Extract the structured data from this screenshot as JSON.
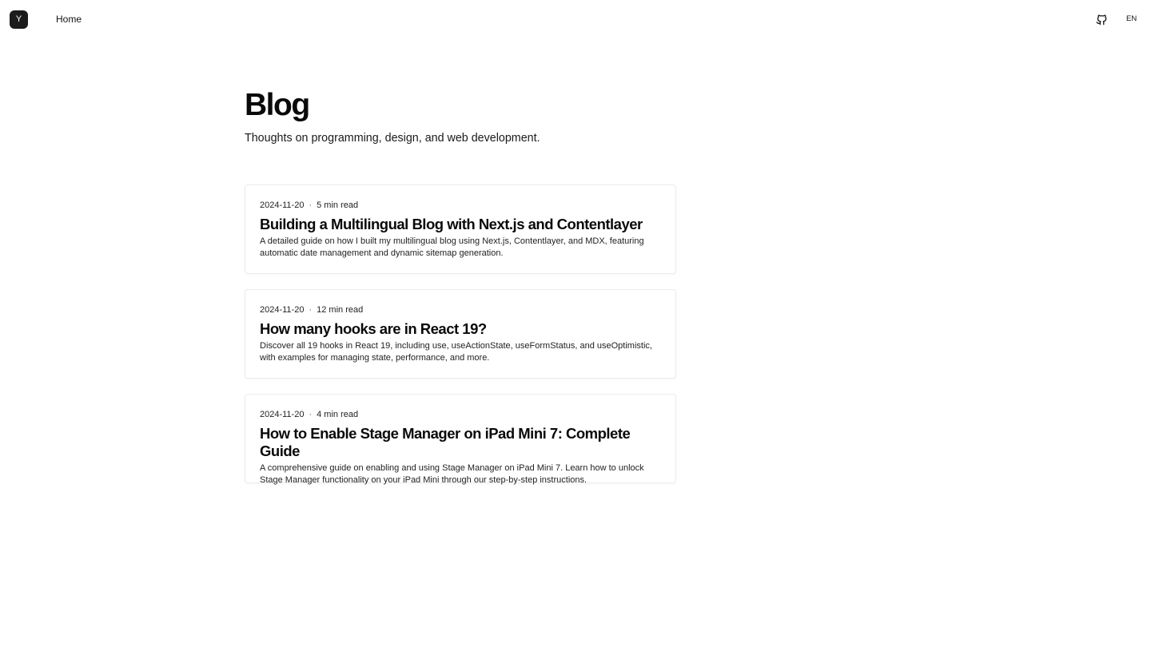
{
  "header": {
    "logo_letter": "Y",
    "nav_home": "Home",
    "github_icon": "github-icon",
    "language": "EN"
  },
  "main": {
    "title": "Blog",
    "subtitle": "Thoughts on programming, design, and web development."
  },
  "posts": [
    {
      "date": "2024-11-20",
      "separator": "·",
      "read_time": "5 min read",
      "title": "Building a Multilingual Blog with Next.js and Contentlayer",
      "description": "A detailed guide on how I built my multilingual blog using Next.js, Contentlayer, and MDX, featuring automatic date management and dynamic sitemap generation."
    },
    {
      "date": "2024-11-20",
      "separator": "·",
      "read_time": "12 min read",
      "title": "How many hooks are in React 19?",
      "description": "Discover all 19 hooks in React 19, including use, useActionState, useFormStatus, and useOptimistic, with examples for managing state, performance, and more."
    },
    {
      "date": "2024-11-20",
      "separator": "·",
      "read_time": "4 min read",
      "title": "How to Enable Stage Manager on iPad Mini 7: Complete Guide",
      "description": "A comprehensive guide on enabling and using Stage Manager on iPad Mini 7. Learn how to unlock Stage Manager functionality on your iPad Mini through our step-by-step instructions."
    }
  ],
  "colors": {
    "logo_bg": "#1c1c1c",
    "card_border": "#ececec",
    "text": "#111111"
  }
}
